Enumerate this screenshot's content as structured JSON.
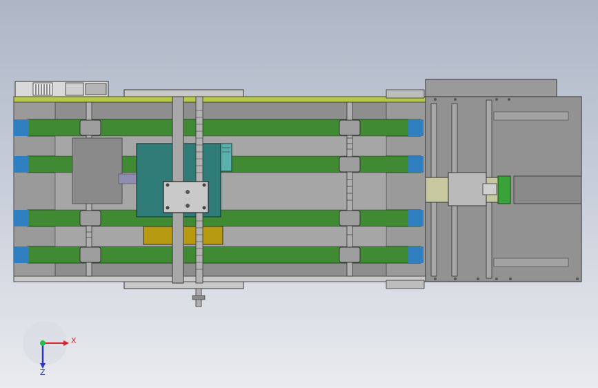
{
  "app": {
    "view": "cad-3d-viewport"
  },
  "triad": {
    "x_label": "X",
    "z_label": "Z",
    "x_color": "#e0202a",
    "y_color": "#22c04a",
    "z_color": "#2a36c8"
  },
  "colors": {
    "frame_yellow": "#b8c84a",
    "belt_green": "#3f8a32",
    "belt_green_light": "#4ea03c",
    "belt_blue": "#2f7ec0",
    "motor_teal": "#2f7b78",
    "body_gray": "#8c8c8c",
    "pad_gold": "#b79a10"
  }
}
